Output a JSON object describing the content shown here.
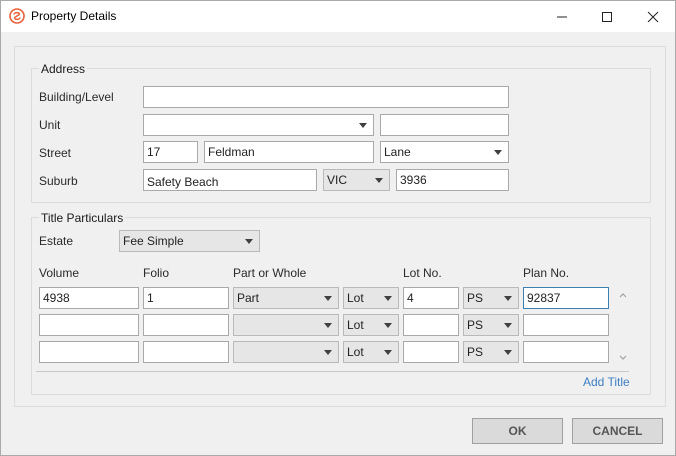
{
  "window": {
    "title": "Property Details"
  },
  "address": {
    "group_label": "Address",
    "building_label": "Building/Level",
    "building_value": "",
    "unit_label": "Unit",
    "unit_type_value": "",
    "unit_value": "",
    "street_label": "Street",
    "street_number": "17",
    "street_name": "Feldman",
    "street_type": "Lane",
    "suburb_label": "Suburb",
    "suburb_value": "Safety Beach",
    "state_value": "VIC",
    "postcode_value": "3936"
  },
  "title": {
    "group_label": "Title Particulars",
    "estate_label": "Estate",
    "estate_value": "Fee Simple",
    "columns": {
      "volume": "Volume",
      "folio": "Folio",
      "part_whole": "Part or Whole",
      "lot": "Lot No.",
      "plan": "Plan No."
    },
    "rows": [
      {
        "volume": "4938",
        "folio": "1",
        "part_whole": "Part",
        "lot_type": "Lot",
        "lot_no": "4",
        "plan_type": "PS",
        "plan_no": "92837"
      },
      {
        "volume": "",
        "folio": "",
        "part_whole": "",
        "lot_type": "Lot",
        "lot_no": "",
        "plan_type": "PS",
        "plan_no": ""
      },
      {
        "volume": "",
        "folio": "",
        "part_whole": "",
        "lot_type": "Lot",
        "lot_no": "",
        "plan_type": "PS",
        "plan_no": ""
      }
    ],
    "add_title_label": "Add Title"
  },
  "buttons": {
    "ok": "OK",
    "cancel": "CANCEL"
  },
  "colors": {
    "accent": "#3d7fc4",
    "brand_icon": "#e8603c"
  }
}
